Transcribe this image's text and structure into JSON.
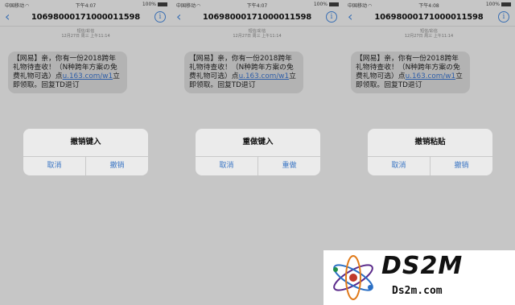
{
  "status_bar": {
    "carrier": "中国移动",
    "wifi_icon": "wifi-icon",
    "times": [
      "下午4:07",
      "下午4:07",
      "下午4:08"
    ],
    "battery": "100%"
  },
  "conversation": {
    "sender": "10698000171000011598",
    "back_icon": "chevron-left-icon",
    "info_icon": "info-icon",
    "info_glyph": "i",
    "meta_line1": "短信/彩信",
    "meta_line2": "12月27日 周三 上午11:14"
  },
  "message": {
    "text_before_link": "【网易】亲，你有一份2018跨年礼物待查收！（N种跨年方案の免费礼物可选）点",
    "link": "u.163.com/w1",
    "text_after_link": "立即领取。回复TD退订"
  },
  "dialogs": [
    {
      "title": "撤销键入",
      "cancel": "取消",
      "action": "撤销"
    },
    {
      "title": "重做键入",
      "cancel": "取消",
      "action": "重做"
    },
    {
      "title": "撤销粘贴",
      "cancel": "取消",
      "action": "撤销"
    }
  ],
  "watermark": {
    "brand": "DS2M",
    "url": "Ds2m.com"
  },
  "colors": {
    "accent": "#3a75c4",
    "link": "#2f5fa8",
    "overlay": "#c6c6c6"
  }
}
